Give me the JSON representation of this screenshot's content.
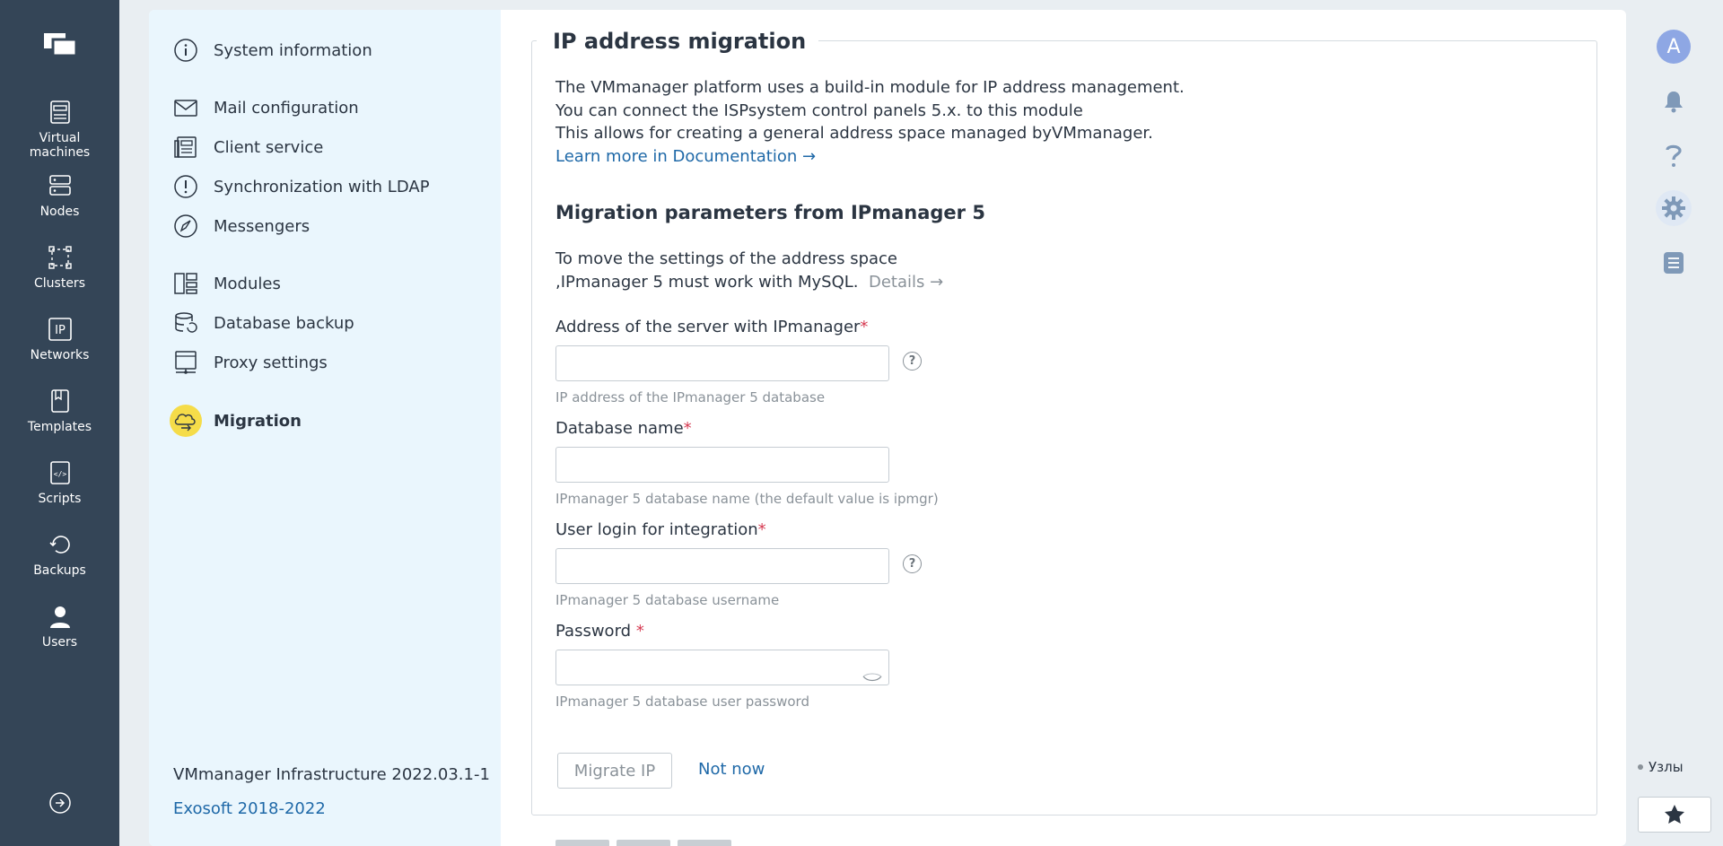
{
  "nav": {
    "items": [
      {
        "label_line1": "Virtual",
        "label_line2": "machines",
        "icon": "virtual-machine-icon"
      },
      {
        "label": "Nodes",
        "icon": "nodes-icon"
      },
      {
        "label": "Clusters",
        "icon": "clusters-icon"
      },
      {
        "label": "Networks",
        "icon": "ip-icon",
        "icon_text": "IP"
      },
      {
        "label": "Templates",
        "icon": "template-icon"
      },
      {
        "label": "Scripts",
        "icon": "script-icon",
        "icon_text": "</>"
      },
      {
        "label": "Backups",
        "icon": "backup-icon"
      },
      {
        "label": "Users",
        "icon": "user-icon"
      }
    ]
  },
  "sidebar": {
    "items": [
      {
        "label": "System information",
        "icon": "info-icon"
      },
      {
        "label": "Mail configuration",
        "icon": "mail-icon"
      },
      {
        "label": "Client service",
        "icon": "client-service-icon"
      },
      {
        "label": "Synchronization with LDAP",
        "icon": "warning-icon"
      },
      {
        "label": "Messengers",
        "icon": "messenger-icon"
      },
      {
        "label": "Modules",
        "icon": "modules-icon"
      },
      {
        "label": "Database backup",
        "icon": "database-icon"
      },
      {
        "label": "Proxy settings",
        "icon": "proxy-icon"
      },
      {
        "label": "Migration",
        "icon": "migration-icon",
        "active": true
      }
    ],
    "version": "VMmanager Infrastructure 2022.03.1-1",
    "copyright": "Exosoft 2018-2022"
  },
  "form": {
    "title": "IP address migration",
    "intro_line1": "The VMmanager platform uses a build-in module for IP address management.",
    "intro_line2": "You can connect the ISPsystem control panels 5.x. to this module",
    "intro_line3": "This allows for creating a general address space managed byVMmanager.",
    "learn_more": "Learn more in Documentation →",
    "section_title": "Migration parameters from IPmanager 5",
    "move_line1": "To move the settings of the address space",
    "move_line2": ",IPmanager 5 must work with MySQL.",
    "details_link": "Details →",
    "fields": {
      "address": {
        "label": "Address of the server with IPmanager",
        "required": "*",
        "value": "",
        "hint": "IP address of the IPmanager 5 database"
      },
      "dbname": {
        "label": "Database name",
        "required": "*",
        "value": "",
        "hint": "IPmanager 5 database name (the default value is ipmgr)"
      },
      "login": {
        "label": "User login for integration",
        "required": "*",
        "value": "",
        "hint": "IPmanager 5 database username"
      },
      "password": {
        "label": "Password ",
        "required": "*",
        "value": "",
        "hint": "IPmanager 5 database user password"
      }
    },
    "help_symbol": "?",
    "migrate_button": "Migrate IP",
    "not_now": "Not now"
  },
  "rightrail": {
    "avatar_letter": "A",
    "nodes_label": "Узлы"
  },
  "colors": {
    "nav_bg": "#344557",
    "sidebar_bg": "#eaf6fd",
    "accent_link": "#1f69a8",
    "active_highlight": "#f5dc49",
    "required": "#d63b52"
  }
}
